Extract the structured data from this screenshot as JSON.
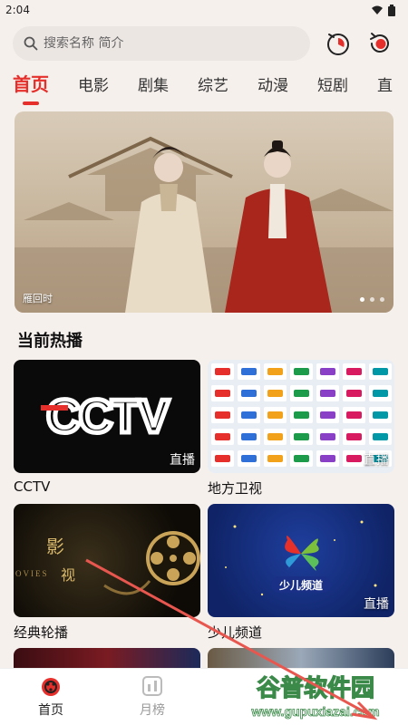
{
  "status_bar": {
    "time": "2:04"
  },
  "search": {
    "placeholder": "搜索名称 简介"
  },
  "icons": {
    "search": "search-icon",
    "history": "history-icon",
    "refresh": "refresh-icon"
  },
  "tabs": [
    {
      "label": "首页",
      "active": true
    },
    {
      "label": "电影"
    },
    {
      "label": "剧集"
    },
    {
      "label": "综艺"
    },
    {
      "label": "动漫"
    },
    {
      "label": "短剧"
    },
    {
      "label": "直"
    }
  ],
  "banner": {
    "caption": "雁回时"
  },
  "section": {
    "title": "当前热播"
  },
  "cards": [
    {
      "label": "CCTV",
      "badge": "直播",
      "logo": "CCTV"
    },
    {
      "label": "地方卫视",
      "badge": "直播"
    },
    {
      "label": "经典轮播",
      "art_text_1": "影",
      "art_text_2": "视",
      "art_text_3": "OVIES"
    },
    {
      "label": "少儿频道",
      "badge": "直播",
      "logo": "少儿频道"
    }
  ],
  "bottom_nav": [
    {
      "label": "首页",
      "active": true
    },
    {
      "label": "月榜"
    }
  ],
  "watermark": {
    "title": "谷普软件园",
    "url": "www.gupuxiazai.com"
  },
  "colors": {
    "accent": "#e62e2a",
    "background": "#f6f0ed"
  }
}
